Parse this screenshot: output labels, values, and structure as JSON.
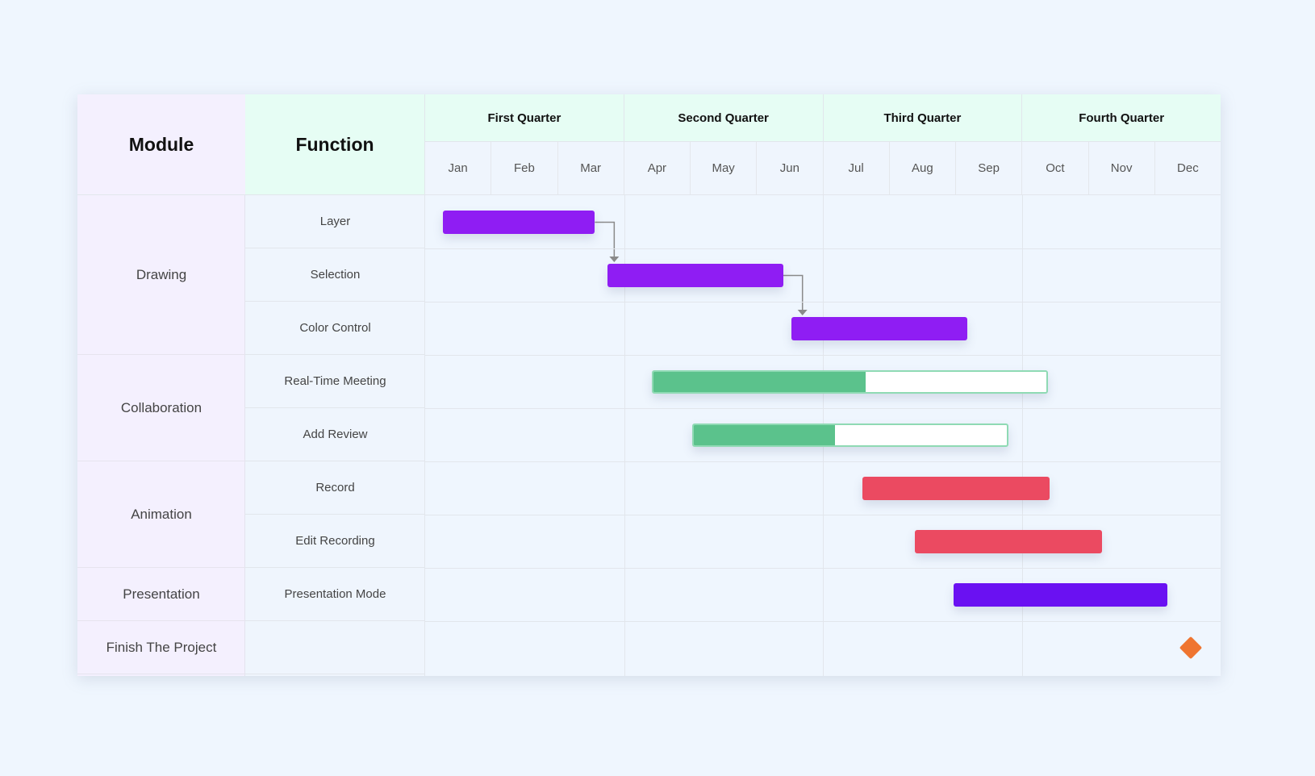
{
  "chart_data": {
    "type": "gantt",
    "title": "",
    "header": {
      "module_label": "Module",
      "function_label": "Function"
    },
    "quarters": [
      "First Quarter",
      "Second Quarter",
      "Third Quarter",
      "Fourth Quarter"
    ],
    "months": [
      "Jan",
      "Feb",
      "Mar",
      "Apr",
      "May",
      "Jun",
      "Jul",
      "Aug",
      "Sep",
      "Oct",
      "Nov",
      "Dec"
    ],
    "x_range_months": [
      0,
      12
    ],
    "modules": [
      {
        "name": "Drawing",
        "rows": 3
      },
      {
        "name": "Collaboration",
        "rows": 2
      },
      {
        "name": "Animation",
        "rows": 2
      },
      {
        "name": "Presentation",
        "rows": 1
      },
      {
        "name": "Finish The Project",
        "rows": 1
      }
    ],
    "tasks": [
      {
        "module": "Drawing",
        "function": "Layer",
        "start": 0.27,
        "end": 2.56,
        "color": "#8f1df3",
        "progress": null
      },
      {
        "module": "Drawing",
        "function": "Selection",
        "start": 2.75,
        "end": 5.4,
        "color": "#8f1df3",
        "progress": null
      },
      {
        "module": "Drawing",
        "function": "Color Control",
        "start": 5.53,
        "end": 8.18,
        "color": "#8f1df3",
        "progress": null
      },
      {
        "module": "Collaboration",
        "function": "Real-Time Meeting",
        "start": 3.42,
        "end": 9.4,
        "color": "#5bc28c",
        "progress": 0.54
      },
      {
        "module": "Collaboration",
        "function": "Add Review",
        "start": 4.03,
        "end": 8.8,
        "color": "#5bc28c",
        "progress": 0.45
      },
      {
        "module": "Animation",
        "function": "Record",
        "start": 6.6,
        "end": 9.42,
        "color": "#eb4a61",
        "progress": null
      },
      {
        "module": "Animation",
        "function": "Edit Recording",
        "start": 7.39,
        "end": 10.21,
        "color": "#eb4a61",
        "progress": null
      },
      {
        "module": "Presentation",
        "function": "Presentation Mode",
        "start": 7.97,
        "end": 11.2,
        "color": "#6a11f2",
        "progress": null
      },
      {
        "module": "Finish The Project",
        "function": "",
        "milestone": 11.55,
        "color": "#ef7530"
      }
    ],
    "dependencies": [
      {
        "from": "Layer",
        "to": "Selection"
      },
      {
        "from": "Selection",
        "to": "Color Control"
      }
    ],
    "colors": {
      "module_bg": "#f4f0fe",
      "header_bg": "#e6fdf4",
      "body_bg": "#eff5fd",
      "grid": "#e2e6ec",
      "connector": "#8a8a8a",
      "progress_remaining": "#ffffff",
      "progress_border": "#8fdab4"
    }
  }
}
